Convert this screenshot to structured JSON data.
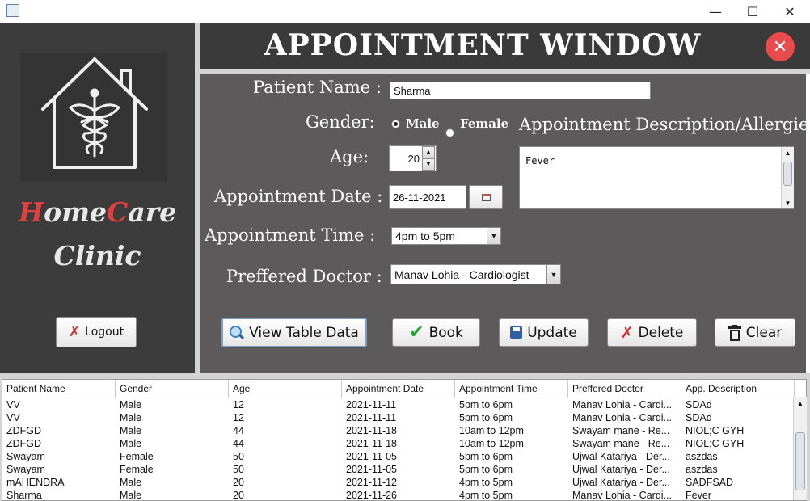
{
  "window": {
    "min_glyph": "—",
    "max_glyph": "☐",
    "close_glyph": "✕"
  },
  "sidebar": {
    "brand_line1_a": "H",
    "brand_line1_b": "ome",
    "brand_line1_c": "C",
    "brand_line1_d": "are",
    "brand_line2": "Clinic",
    "logout_label": "Logout"
  },
  "header": {
    "title": "APPOINTMENT WINDOW",
    "close_glyph": "✕"
  },
  "form": {
    "patient_name_label": "Patient Name :",
    "patient_name_value": "Sharma",
    "gender_label": "Gender:",
    "gender_male": "Male",
    "gender_female": "Female",
    "gender_selected": "Male",
    "age_label": "Age:",
    "age_value": "20",
    "date_label": "Appointment Date :",
    "date_value": "26-11-2021",
    "time_label": "Appointment Time :",
    "time_value": "4pm to 5pm",
    "doctor_label": "Preffered Doctor :",
    "doctor_value": "Manav Lohia - Cardiologist",
    "desc_label": "Appointment Description/Allergies:",
    "desc_value": "Fever"
  },
  "buttons": {
    "view": "View Table Data",
    "book": "Book",
    "update": "Update",
    "delete": "Delete",
    "clear": "Clear"
  },
  "table": {
    "columns": [
      "Patient Name",
      "Gender",
      "Age",
      "Appointment Date",
      "Appointment Time",
      "Preffered Doctor",
      "App. Description"
    ],
    "rows": [
      [
        "VV",
        "Male",
        "12",
        "2021-11-11",
        "5pm to 6pm",
        "Manav Lohia - Cardi...",
        "SDAd"
      ],
      [
        "VV",
        "Male",
        "12",
        "2021-11-11",
        "5pm to 6pm",
        "Manav Lohia - Cardi...",
        "SDAd"
      ],
      [
        "ZDFGD",
        "Male",
        "44",
        "2021-11-18",
        "10am to 12pm",
        "Swayam mane - Re...",
        "NIOL;C GYH"
      ],
      [
        "ZDFGD",
        "Male",
        "44",
        "2021-11-18",
        "10am to 12pm",
        "Swayam mane - Re...",
        "NIOL;C GYH"
      ],
      [
        "Swayam",
        "Female",
        "50",
        "2021-11-05",
        "5pm to 6pm",
        "Ujwal Katariya - Der...",
        "aszdas"
      ],
      [
        "Swayam",
        "Female",
        "50",
        "2021-11-05",
        "5pm to 6pm",
        "Ujwal Katariya - Der...",
        "aszdas"
      ],
      [
        "mAHENDRA",
        "Male",
        "20",
        "2021-11-12",
        "4pm to 5pm",
        "Ujwal Katariya - Der...",
        "SADFSAD"
      ],
      [
        "Sharma",
        "Male",
        "20",
        "2021-11-26",
        "4pm to 5pm",
        "Manav Lohia - Cardi...",
        "Fever"
      ]
    ]
  },
  "colors": {
    "accent_red": "#e0403f",
    "panel_dark": "#3c3c3c",
    "form_bg": "#5c5a5a",
    "close_red": "#e84b4b"
  }
}
